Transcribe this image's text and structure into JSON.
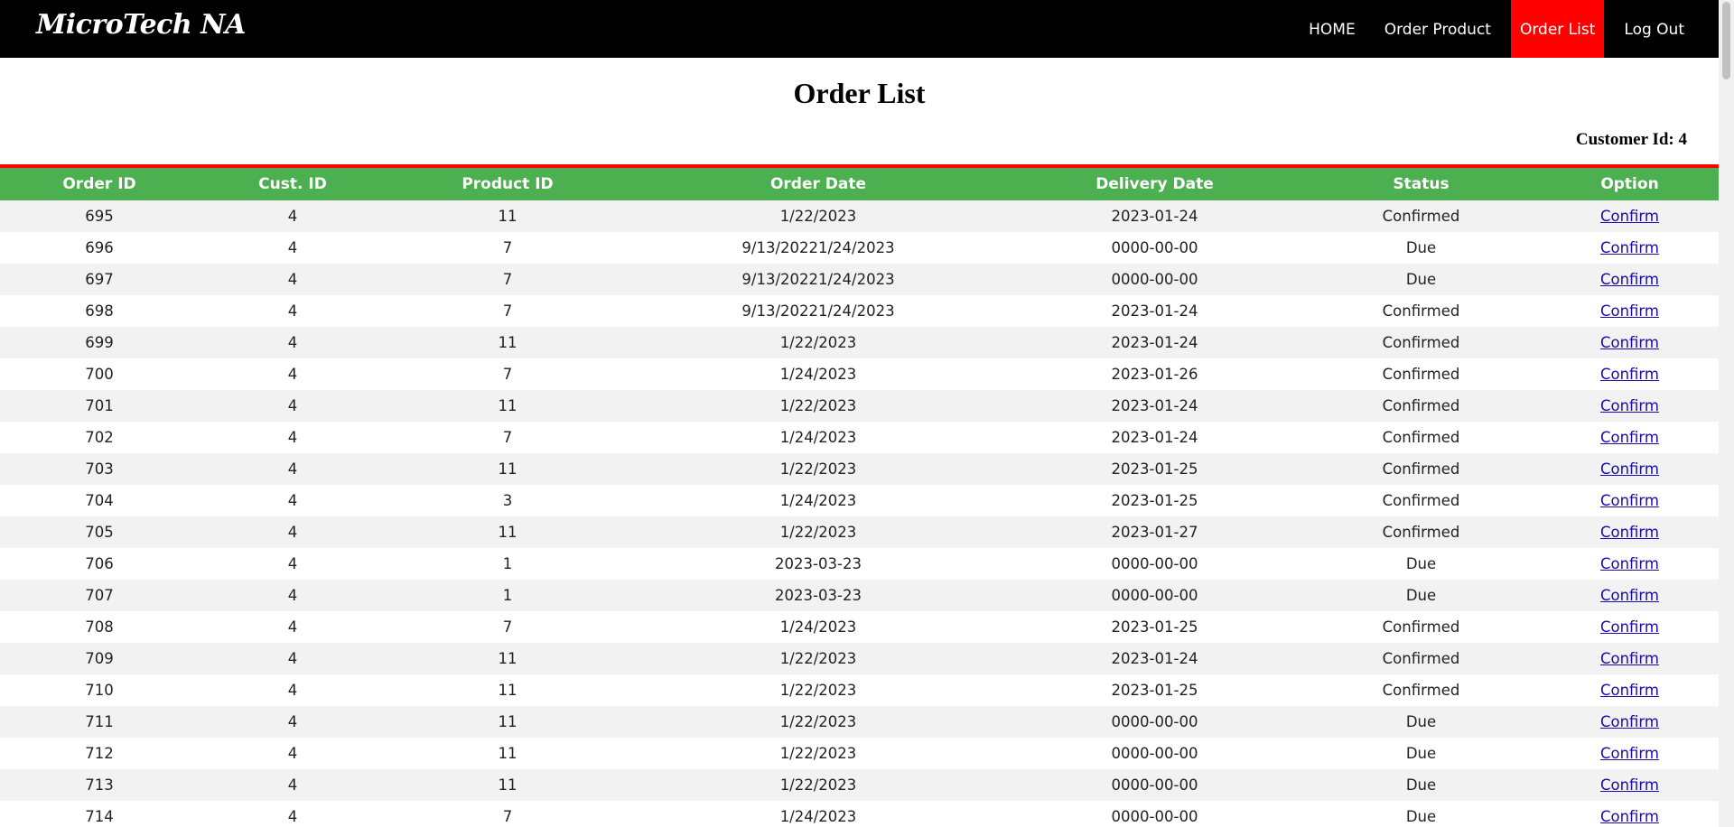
{
  "navbar": {
    "brand": "MicroTech NA",
    "links": [
      "HOME",
      "Order Product",
      "Order List",
      "Log Out"
    ]
  },
  "page": {
    "title": "Order List",
    "customer_id_label": "Customer Id: 4"
  },
  "table": {
    "headers": [
      "Order ID",
      "Cust. ID",
      "Product ID",
      "Order Date",
      "Delivery Date",
      "Status",
      "Option"
    ],
    "rows": [
      {
        "order_id": "695",
        "cust_id": "4",
        "product_id": "11",
        "order_date": "1/22/2023",
        "delivery_date": "2023-01-24",
        "status": "Confirmed",
        "option": "Confirm"
      },
      {
        "order_id": "696",
        "cust_id": "4",
        "product_id": "7",
        "order_date": "9/13/20221/24/2023",
        "delivery_date": "0000-00-00",
        "status": "Due",
        "option": "Confirm"
      },
      {
        "order_id": "697",
        "cust_id": "4",
        "product_id": "7",
        "order_date": "9/13/20221/24/2023",
        "delivery_date": "0000-00-00",
        "status": "Due",
        "option": "Confirm"
      },
      {
        "order_id": "698",
        "cust_id": "4",
        "product_id": "7",
        "order_date": "9/13/20221/24/2023",
        "delivery_date": "2023-01-24",
        "status": "Confirmed",
        "option": "Confirm"
      },
      {
        "order_id": "699",
        "cust_id": "4",
        "product_id": "11",
        "order_date": "1/22/2023",
        "delivery_date": "2023-01-24",
        "status": "Confirmed",
        "option": "Confirm"
      },
      {
        "order_id": "700",
        "cust_id": "4",
        "product_id": "7",
        "order_date": "1/24/2023",
        "delivery_date": "2023-01-26",
        "status": "Confirmed",
        "option": "Confirm"
      },
      {
        "order_id": "701",
        "cust_id": "4",
        "product_id": "11",
        "order_date": "1/22/2023",
        "delivery_date": "2023-01-24",
        "status": "Confirmed",
        "option": "Confirm"
      },
      {
        "order_id": "702",
        "cust_id": "4",
        "product_id": "7",
        "order_date": "1/24/2023",
        "delivery_date": "2023-01-24",
        "status": "Confirmed",
        "option": "Confirm"
      },
      {
        "order_id": "703",
        "cust_id": "4",
        "product_id": "11",
        "order_date": "1/22/2023",
        "delivery_date": "2023-01-25",
        "status": "Confirmed",
        "option": "Confirm"
      },
      {
        "order_id": "704",
        "cust_id": "4",
        "product_id": "3",
        "order_date": "1/24/2023",
        "delivery_date": "2023-01-25",
        "status": "Confirmed",
        "option": "Confirm"
      },
      {
        "order_id": "705",
        "cust_id": "4",
        "product_id": "11",
        "order_date": "1/22/2023",
        "delivery_date": "2023-01-27",
        "status": "Confirmed",
        "option": "Confirm"
      },
      {
        "order_id": "706",
        "cust_id": "4",
        "product_id": "1",
        "order_date": "2023-03-23",
        "delivery_date": "0000-00-00",
        "status": "Due",
        "option": "Confirm"
      },
      {
        "order_id": "707",
        "cust_id": "4",
        "product_id": "1",
        "order_date": "2023-03-23",
        "delivery_date": "0000-00-00",
        "status": "Due",
        "option": "Confirm"
      },
      {
        "order_id": "708",
        "cust_id": "4",
        "product_id": "7",
        "order_date": "1/24/2023",
        "delivery_date": "2023-01-25",
        "status": "Confirmed",
        "option": "Confirm"
      },
      {
        "order_id": "709",
        "cust_id": "4",
        "product_id": "11",
        "order_date": "1/22/2023",
        "delivery_date": "2023-01-24",
        "status": "Confirmed",
        "option": "Confirm"
      },
      {
        "order_id": "710",
        "cust_id": "4",
        "product_id": "11",
        "order_date": "1/22/2023",
        "delivery_date": "2023-01-25",
        "status": "Confirmed",
        "option": "Confirm"
      },
      {
        "order_id": "711",
        "cust_id": "4",
        "product_id": "11",
        "order_date": "1/22/2023",
        "delivery_date": "0000-00-00",
        "status": "Due",
        "option": "Confirm"
      },
      {
        "order_id": "712",
        "cust_id": "4",
        "product_id": "11",
        "order_date": "1/22/2023",
        "delivery_date": "0000-00-00",
        "status": "Due",
        "option": "Confirm"
      },
      {
        "order_id": "713",
        "cust_id": "4",
        "product_id": "11",
        "order_date": "1/22/2023",
        "delivery_date": "0000-00-00",
        "status": "Due",
        "option": "Confirm"
      },
      {
        "order_id": "714",
        "cust_id": "4",
        "product_id": "7",
        "order_date": "1/24/2023",
        "delivery_date": "0000-00-00",
        "status": "Due",
        "option": "Confirm"
      }
    ]
  },
  "colors": {
    "navbar_bg": "#000000",
    "active_nav_bg": "#ff0000",
    "header_bg": "#4caf50",
    "rule": "#ff0000",
    "link": "#1a0dab"
  }
}
